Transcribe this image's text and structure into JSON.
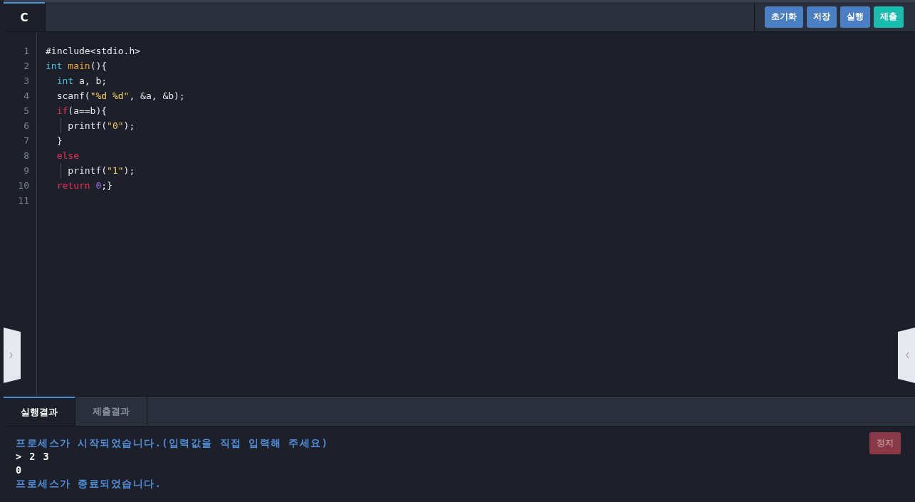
{
  "editor_tabs": [
    {
      "label": "C",
      "selected": true
    }
  ],
  "toolbar_buttons": [
    {
      "label": "초기화",
      "color": "#4a7fc4"
    },
    {
      "label": "저장",
      "color": "#4a7fc4"
    },
    {
      "label": "실행",
      "color": "#4a7fc4"
    },
    {
      "label": "제출",
      "color": "#1bbcb0"
    }
  ],
  "code_lines": [
    {
      "number": "1",
      "tokens": [
        {
          "kind": "plain",
          "text": "#include<stdio.h>"
        }
      ]
    },
    {
      "number": "2",
      "tokens": [
        {
          "kind": "type",
          "text": "int"
        },
        {
          "kind": "func",
          "text": " main"
        },
        {
          "kind": "plain",
          "text": "(){"
        }
      ]
    },
    {
      "number": "3",
      "tokens": [
        {
          "kind": "type",
          "text": "  int"
        },
        {
          "kind": "plain",
          "text": " a, b;"
        }
      ]
    },
    {
      "number": "4",
      "tokens": [
        {
          "kind": "plain",
          "text": "  scanf("
        },
        {
          "kind": "string",
          "text": "\"%d %d\""
        },
        {
          "kind": "plain",
          "text": ", &a, &b);"
        }
      ]
    },
    {
      "number": "5",
      "tokens": [
        {
          "kind": "keyword",
          "text": "  if"
        },
        {
          "kind": "plain",
          "text": "(a==b){"
        }
      ]
    },
    {
      "number": "6",
      "guide": true,
      "tokens": [
        {
          "kind": "plain",
          "text": "    printf("
        },
        {
          "kind": "string",
          "text": "\"0\""
        },
        {
          "kind": "plain",
          "text": ");"
        }
      ]
    },
    {
      "number": "7",
      "tokens": [
        {
          "kind": "plain",
          "text": "  }"
        }
      ]
    },
    {
      "number": "8",
      "tokens": [
        {
          "kind": "keyword",
          "text": "  else"
        }
      ]
    },
    {
      "number": "9",
      "guide": true,
      "tokens": [
        {
          "kind": "plain",
          "text": "    printf("
        },
        {
          "kind": "string",
          "text": "\"1\""
        },
        {
          "kind": "plain",
          "text": ");"
        }
      ]
    },
    {
      "number": "10",
      "tokens": [
        {
          "kind": "keyword",
          "text": "  return"
        },
        {
          "kind": "number",
          "text": " 0"
        },
        {
          "kind": "plain",
          "text": ";}"
        }
      ]
    },
    {
      "number": "11"
    }
  ],
  "result_tabs": [
    {
      "label": "실행결과",
      "selected": true
    },
    {
      "label": "제출결과",
      "selected": false
    }
  ],
  "stop_button": {
    "label": "정지"
  },
  "console_lines": [
    {
      "kind": "info",
      "text": "프로세스가 시작되었습니다.(입력값을 직접 입력해 주세요)"
    },
    {
      "kind": "io",
      "text": "> 2 3"
    },
    {
      "kind": "io",
      "text": "0"
    },
    {
      "kind": "info",
      "text": "프로세스가 종료되었습니다."
    }
  ]
}
